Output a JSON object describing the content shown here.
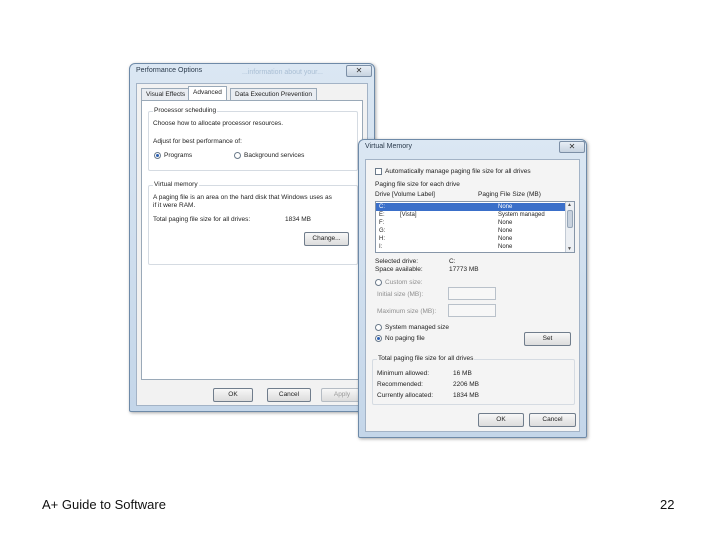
{
  "slide": {
    "footer_left": "A+ Guide to Software",
    "page_number": "22"
  },
  "performance_options": {
    "title": "Performance Options",
    "ghost_text": "...information about your...",
    "close_glyph": "✕",
    "tabs": [
      "Visual Effects",
      "Advanced",
      "Data Execution Prevention"
    ],
    "processor": {
      "heading": "Processor scheduling",
      "desc": "Choose how to allocate processor resources.",
      "adjust": "Adjust for best performance of:",
      "opt_programs": "Programs",
      "opt_background": "Background services"
    },
    "virtual_memory": {
      "heading": "Virtual memory",
      "desc1": "A paging file is an area on the hard disk that Windows uses as",
      "desc2": "if it were RAM.",
      "total_label": "Total paging file size for all drives:",
      "total_value": "1834 MB",
      "change_button": "Change..."
    },
    "buttons": {
      "ok": "OK",
      "cancel": "Cancel",
      "apply": "Apply"
    }
  },
  "virtual_memory_dialog": {
    "title": "Virtual Memory",
    "close_glyph": "✕",
    "auto_manage": "Automatically manage paging file size for all drives",
    "section": "Paging file size for each drive",
    "col_drive": "Drive  [Volume Label]",
    "col_size": "Paging File Size (MB)",
    "drives": [
      {
        "drive": "C:",
        "label": "",
        "size": "None"
      },
      {
        "drive": "E:",
        "label": "[Vista]",
        "size": "System managed"
      },
      {
        "drive": "F:",
        "label": "",
        "size": "None"
      },
      {
        "drive": "G:",
        "label": "",
        "size": "None"
      },
      {
        "drive": "H:",
        "label": "",
        "size": "None"
      },
      {
        "drive": "I:",
        "label": "",
        "size": "None"
      }
    ],
    "selected_drive_label": "Selected drive:",
    "selected_drive_value": "C:",
    "space_label": "Space available:",
    "space_value": "17773 MB",
    "custom_size": "Custom size:",
    "initial_size": "Initial size (MB):",
    "maximum_size": "Maximum size (MB):",
    "system_managed": "System managed size",
    "no_paging": "No paging file",
    "set_button": "Set",
    "totals_heading": "Total paging file size for all drives",
    "min_label": "Minimum allowed:",
    "min_value": "16 MB",
    "rec_label": "Recommended:",
    "rec_value": "2206 MB",
    "cur_label": "Currently allocated:",
    "cur_value": "1834 MB",
    "ok": "OK",
    "cancel": "Cancel"
  }
}
